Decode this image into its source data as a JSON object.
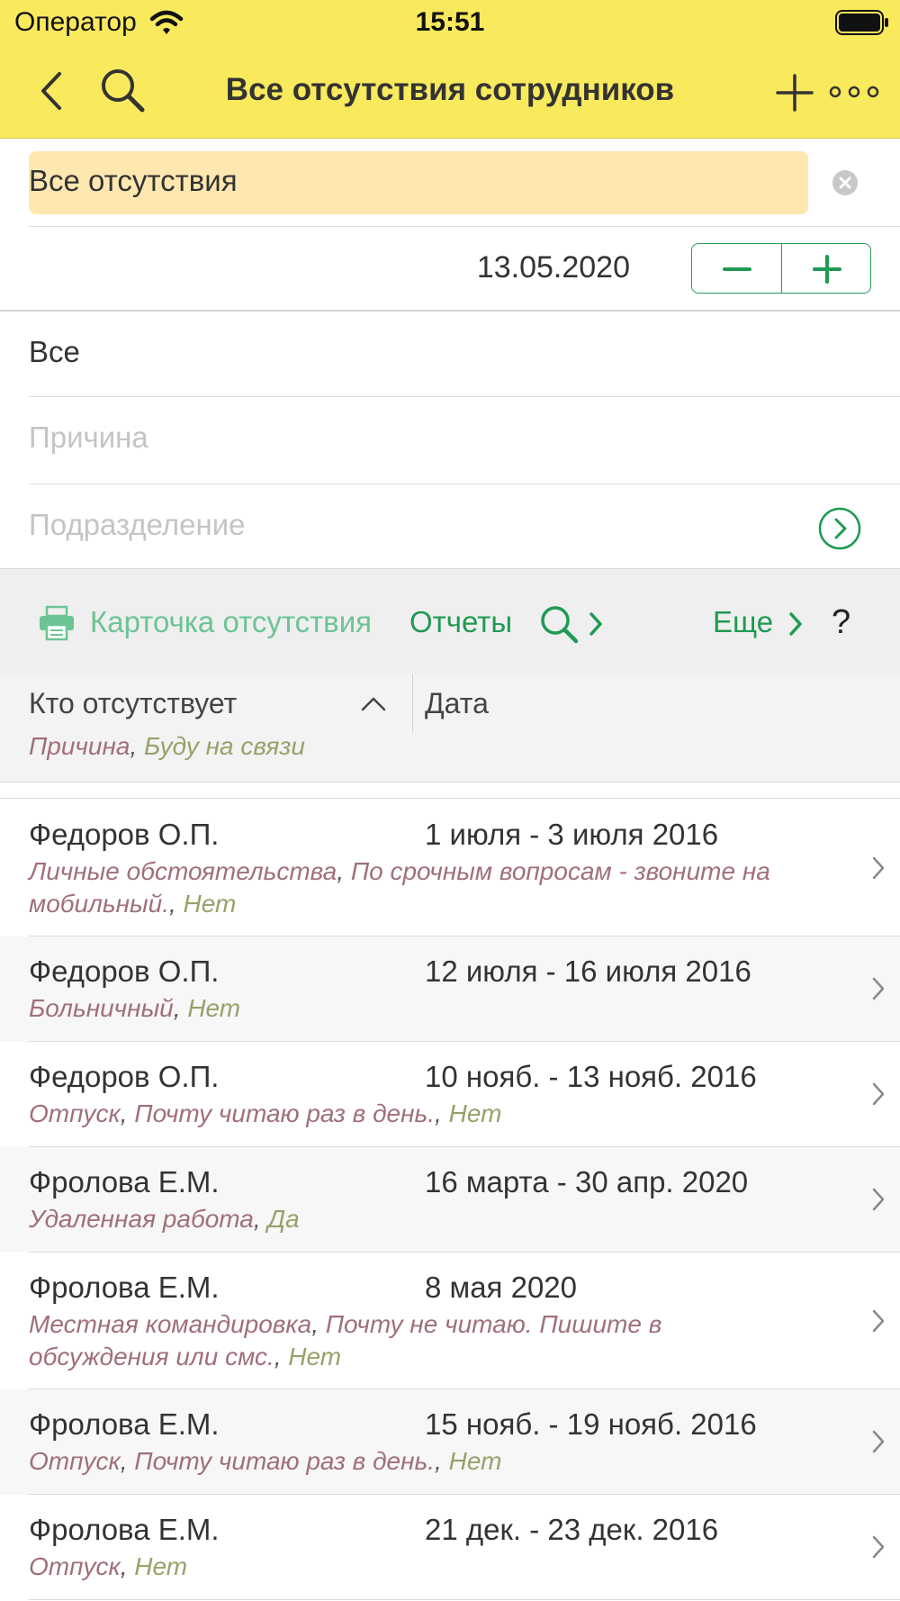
{
  "status_bar": {
    "carrier": "Оператор",
    "time": "15:51"
  },
  "nav": {
    "title": "Все отсутствия сотрудников"
  },
  "filter": {
    "value": "Все отсутствия"
  },
  "date_row": {
    "date": "13.05.2020"
  },
  "selectors": {
    "mode_value": "Все",
    "reason_placeholder": "Причина",
    "department_placeholder": "Подразделение"
  },
  "commands": {
    "card": "Карточка отсутствия",
    "reports": "Отчеты",
    "more": "Еще",
    "help": "?"
  },
  "table": {
    "col_who": "Кто отсутствует",
    "col_date": "Дата",
    "sub_reason": "Причина",
    "sub_comma": ", ",
    "sub_available": "Буду на связи"
  },
  "colors": {
    "accent": "#1f9a52",
    "header_bg": "#f9e95c",
    "filter_bg": "#ffe7b0"
  },
  "rows": [
    {
      "name": "Федоров О.П.",
      "period": "1 июля - 3 июля 2016",
      "reason": "Личные обстоятельства",
      "comment_line1": "По срочным вопросам - звоните на",
      "comment_line2": "мобильный.",
      "available": "Нет"
    },
    {
      "name": "Федоров О.П.",
      "period": "12 июля - 16 июля 2016",
      "reason": "Больничный",
      "available": "Нет"
    },
    {
      "name": "Федоров О.П.",
      "period": "10 нояб. - 13 нояб. 2016",
      "reason": "Отпуск",
      "comment": "Почту читаю раз в день.",
      "available": "Нет"
    },
    {
      "name": "Фролова Е.М.",
      "period": "16 марта - 30 апр. 2020",
      "reason": "Удаленная работа",
      "available": "Да"
    },
    {
      "name": "Фролова Е.М.",
      "period": "8 мая 2020",
      "reason": "Местная командировка",
      "comment_line1": "Почту не читаю. Пишите в",
      "comment_line2": "обсуждения или смс.",
      "available": "Нет"
    },
    {
      "name": "Фролова Е.М.",
      "period": "15 нояб. - 19 нояб. 2016",
      "reason": "Отпуск",
      "comment": "Почту читаю раз в день.",
      "available": "Нет"
    },
    {
      "name": "Фролова Е.М.",
      "period": "21 дек. - 23 дек. 2016",
      "reason": "Отпуск",
      "available": "Нет"
    }
  ]
}
